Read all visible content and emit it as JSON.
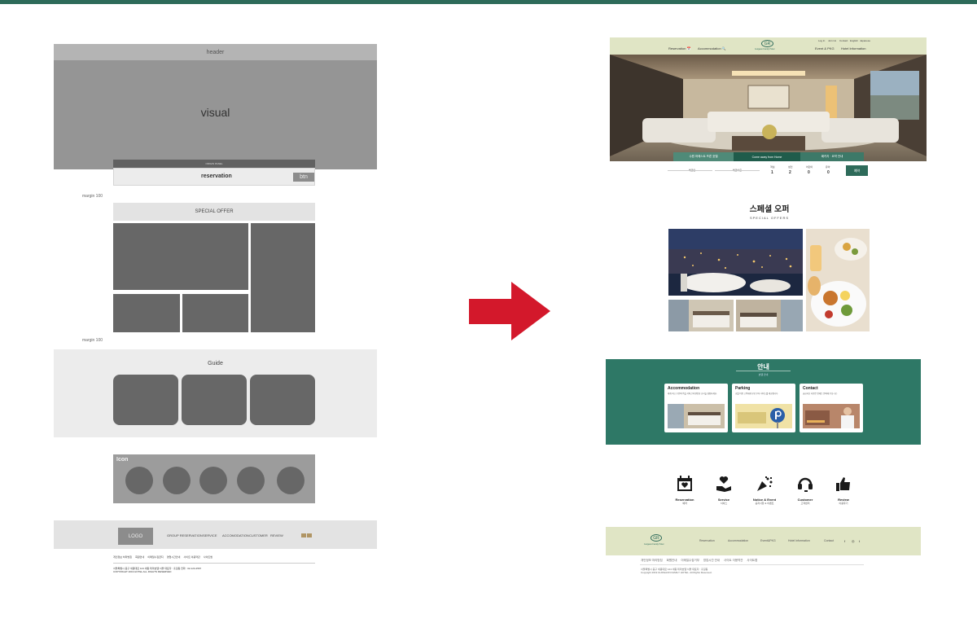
{
  "colors": {
    "accent": "#2e6b5a",
    "arrow": "#d3182b",
    "beige": "#e0e5c5"
  },
  "wireframe": {
    "header_label": "header",
    "visual_label": "visual",
    "quickbar_label": "ORIGIN PANEL",
    "reservation_label": "reservation",
    "button_label": "btn",
    "margin1_label": "margin 100",
    "margin2_label": "margin 100",
    "special_offer_label": "SPECIAL OFFER",
    "guide_label": "Guide",
    "icon_label": "Icon",
    "footer": {
      "logo_label": "LOGO",
      "nav": [
        "GROUP RESERVATION",
        "SERVICE",
        "ACCOMODATION",
        "CUSTOMER",
        "REVIEW"
      ],
      "links": [
        "개인정보 처리방침",
        "회원안내",
        "이메일수집금지",
        "영업시간안내",
        "사이트 이용약관",
        "사이트맵"
      ],
      "copy_line1": "서울특별시 중구 세종대로 124 세종 테마호텔 서울 대표자 : 홍길동 전화 : 02-123-4567",
      "copy_line2": "COPYRIGHT 2019 HOTEL ALL RIGHTS RESERVED"
    }
  },
  "mockup": {
    "header": {
      "logo_mark": "GR",
      "logo_text": "Gurgaon Family Hotel",
      "nav_left": [
        "Reservation 📅",
        "Accommodation 🔍"
      ],
      "nav_right": [
        "Event & PKG",
        "Hotel Information"
      ],
      "util": [
        "Log In",
        "Join Us",
        "Contact",
        "English",
        "Japanese"
      ]
    },
    "tabs": [
      "수원 마에스트 프론 호텔",
      "Come away from Home",
      "패키지 · 요약 안내"
    ],
    "reservation": {
      "checkin": "체크인",
      "checkout": "체크아웃",
      "counters": [
        {
          "label": "객실",
          "value": "1"
        },
        {
          "label": "성인",
          "value": "2"
        },
        {
          "label": "어린이",
          "value": "0"
        },
        {
          "label": "유아",
          "value": "0"
        }
      ],
      "button": "예약"
    },
    "special": {
      "title": "스페셜 오퍼",
      "subtitle": "SPECIAL OFFERS"
    },
    "guide": {
      "title": "안내",
      "subtitle": "호텔 안내",
      "cards": [
        {
          "title": "Accommodation",
          "text": "세계 최고 수준의 객실 서비스와 편안한 휴식을 경험하세요."
        },
        {
          "title": "Parking",
          "text": "호텔 이용 고객에게 무료 주차 서비스를 제공합니다."
        },
        {
          "title": "Contact",
          "text": "궁금하신 사항은 언제든 문의해 주십시오."
        }
      ]
    },
    "icons": [
      {
        "label": "Reservation",
        "sub": "예약"
      },
      {
        "label": "Service",
        "sub": "서비스"
      },
      {
        "label": "Notice & Event",
        "sub": "공지사항 & 이벤트"
      },
      {
        "label": "Customer",
        "sub": "고객센터"
      },
      {
        "label": "Review",
        "sub": "이용후기"
      }
    ],
    "footer": {
      "logo_mark": "GR",
      "logo_text": "Gurgaon Family Hotel",
      "nav": [
        "Reservation",
        "Accommodation",
        "Event&PKG",
        "Hotel Information",
        "Contact"
      ],
      "social": [
        "f",
        "◎",
        "t"
      ],
      "links": [
        "개인정보 처리방침",
        "회원안내",
        "이메일수집거부",
        "영업시간 안내",
        "사이트 이용약관",
        "사이트맵"
      ],
      "copy_line1": "서울특별시 중구 세종대로 124 세종 테마호텔 서울 대표자 : 홍길동",
      "copy_line2": "Copyright 2019 GURGAON FAMILY HOTEL. All Rights Reserved."
    }
  }
}
